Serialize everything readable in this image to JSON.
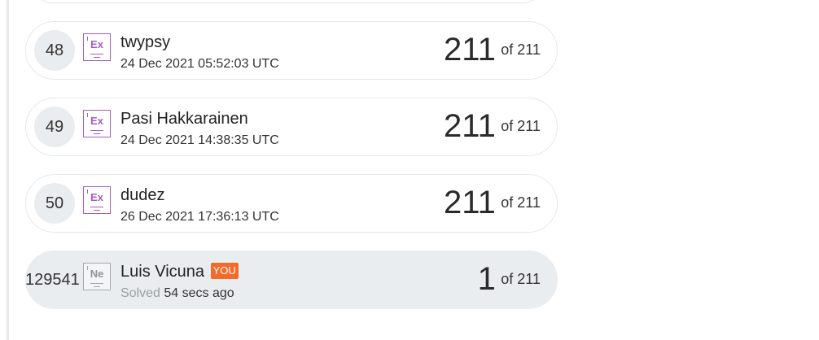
{
  "leaderboard": {
    "entries": [
      {
        "rank": "48",
        "badge": "Ex",
        "name": "twypsy",
        "timestamp": "24 Dec 2021 05:52:03 UTC",
        "score": "211",
        "of_label": "of 211"
      },
      {
        "rank": "49",
        "badge": "Ex",
        "name": "Pasi Hakkarainen",
        "timestamp": "24 Dec 2021 14:38:35 UTC",
        "score": "211",
        "of_label": "of 211"
      },
      {
        "rank": "50",
        "badge": "Ex",
        "name": "dudez",
        "timestamp": "26 Dec 2021 17:36:13 UTC",
        "score": "211",
        "of_label": "of 211"
      }
    ],
    "current_user": {
      "rank": "129541",
      "badge": "Ne",
      "name": "Luis Vicuna",
      "you_label": "YOU",
      "solved_label": "Solved",
      "solved_time": "54 secs ago",
      "score": "1",
      "of_label": "of 211"
    }
  },
  "colors": {
    "expert_badge": "#a45cc4",
    "newbie_badge": "#a2a8ad",
    "you_badge": "#f26b2a",
    "current_row_bg": "#eaedef"
  }
}
